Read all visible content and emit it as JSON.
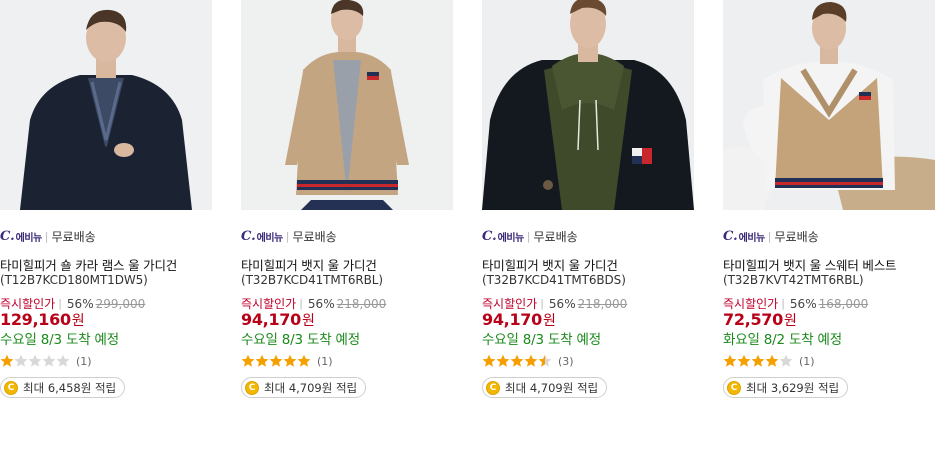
{
  "products": [
    {
      "seller": {
        "brand_mark": "C.",
        "brand_word": "에비뉴",
        "shipping": "무료배송"
      },
      "name": "타미힐피거 숄 카라 램스 울 가디건",
      "code": "(T12B7KCD180MT1DW5)",
      "discount_label": "즉시할인가",
      "discount_pct": "56%",
      "original_price": "299,000",
      "price": "129,160",
      "currency": "원",
      "arrival": "수요일 8/3 도착 예정",
      "rating": 1,
      "review_count": "(1)",
      "reward": "최대 6,458원 적립"
    },
    {
      "seller": {
        "brand_mark": "C.",
        "brand_word": "에비뉴",
        "shipping": "무료배송"
      },
      "name": "타미힐피거 뱃지 울 가디건",
      "code": "(T32B7KCD41TMT6RBL)",
      "discount_label": "즉시할인가",
      "discount_pct": "56%",
      "original_price": "218,000",
      "price": "94,170",
      "currency": "원",
      "arrival": "수요일 8/3 도착 예정",
      "rating": 5,
      "review_count": "(1)",
      "reward": "최대 4,709원 적립"
    },
    {
      "seller": {
        "brand_mark": "C.",
        "brand_word": "에비뉴",
        "shipping": "무료배송"
      },
      "name": "타미힐피거 뱃지 울 가디건",
      "code": "(T32B7KCD41TMT6BDS)",
      "discount_label": "즉시할인가",
      "discount_pct": "56%",
      "original_price": "218,000",
      "price": "94,170",
      "currency": "원",
      "arrival": "수요일 8/3 도착 예정",
      "rating": 4.5,
      "review_count": "(3)",
      "reward": "최대 4,709원 적립"
    },
    {
      "seller": {
        "brand_mark": "C.",
        "brand_word": "에비뉴",
        "shipping": "무료배송"
      },
      "name": "타미힐피거 뱃지 울 스웨터 베스트",
      "code": "(T32B7KVT42TMT6RBL)",
      "discount_label": "즉시할인가",
      "discount_pct": "56%",
      "original_price": "168,000",
      "price": "72,570",
      "currency": "원",
      "arrival": "화요일 8/2 도착 예정",
      "rating": 4,
      "review_count": "(1)",
      "reward": "최대 3,629원 적립"
    }
  ],
  "colors": {
    "discount_label": "#c0002a",
    "price": "#b80018",
    "arrival": "#1c8a1c",
    "star_filled": "#f5a000",
    "star_empty": "#d8d8d8",
    "brand": "#3b2a78",
    "coin": "#f2b700"
  },
  "icons": {
    "star": "star-icon",
    "coin": "coin-icon",
    "coin_glyph": "C"
  }
}
